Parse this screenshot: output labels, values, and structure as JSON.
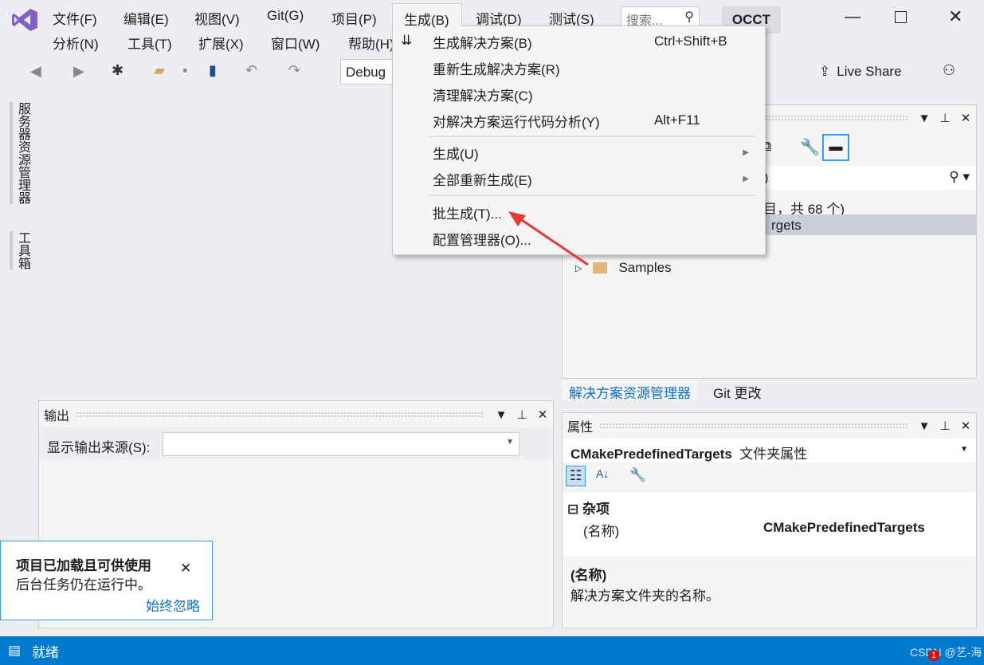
{
  "menubar": {
    "row1": [
      "文件(F)",
      "编辑(E)",
      "视图(V)",
      "Git(G)",
      "项目(P)",
      "生成(B)",
      "调试(D)",
      "测试(S)"
    ],
    "row2": [
      "分析(N)",
      "工具(T)",
      "扩展(X)",
      "窗口(W)",
      "帮助(H)"
    ],
    "search_placeholder": "搜索...",
    "solution_badge": "OCCT"
  },
  "toolbar": {
    "config": "Debug",
    "live_share": "Live Share"
  },
  "side_tabs": [
    "服务器资源管理器",
    "工具箱"
  ],
  "build_menu": {
    "items": [
      {
        "label": "生成解决方案(B)",
        "shortcut": "Ctrl+Shift+B"
      },
      {
        "label": "重新生成解决方案(R)"
      },
      {
        "label": "清理解决方案(C)"
      },
      {
        "label": "对解决方案运行代码分析(Y)",
        "shortcut": "Alt+F11"
      },
      {
        "label": "生成(U)"
      },
      {
        "label": "全部重新生成(E)"
      },
      {
        "label": "批生成(T)..."
      },
      {
        "label": "配置管理器(O)..."
      }
    ]
  },
  "solution_explorer": {
    "search_tail": ";)",
    "summary_tail": "目，共 68 个)",
    "selected_tail": "rgets",
    "tree_item": "Samples",
    "tabs": [
      "解决方案资源管理器",
      "Git 更改"
    ]
  },
  "output": {
    "title": "输出",
    "source_label": "显示输出来源(S):"
  },
  "properties": {
    "title": "属性",
    "object": "CMakePredefinedTargets",
    "object_type": "文件夹属性",
    "category": "杂项",
    "prop_name": "(名称)",
    "prop_value": "CMakePredefinedTargets",
    "desc_title": "(名称)",
    "desc_text": "解决方案文件夹的名称。"
  },
  "notification": {
    "title": "项目已加载且可供使用",
    "body": "后台任务仍在运行中。",
    "link": "始终忽略"
  },
  "status": {
    "text": "就绪",
    "watermark": "CSDN @艺-海",
    "badge": "1"
  },
  "colors": {
    "accent": "#007acc",
    "logo": "#865fc5"
  }
}
